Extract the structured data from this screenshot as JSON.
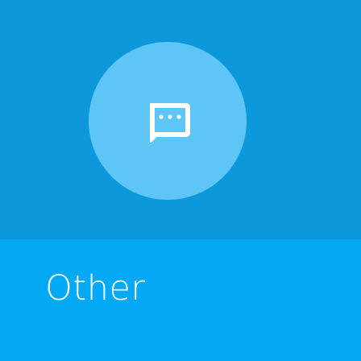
{
  "category": {
    "label": "Other",
    "icon": "chat-bubble-more-icon"
  },
  "colors": {
    "top_background": "#0d98dc",
    "icon_circle": "#5ec6f6",
    "bottom_background": "#03a9f4",
    "text": "#ffffff"
  }
}
